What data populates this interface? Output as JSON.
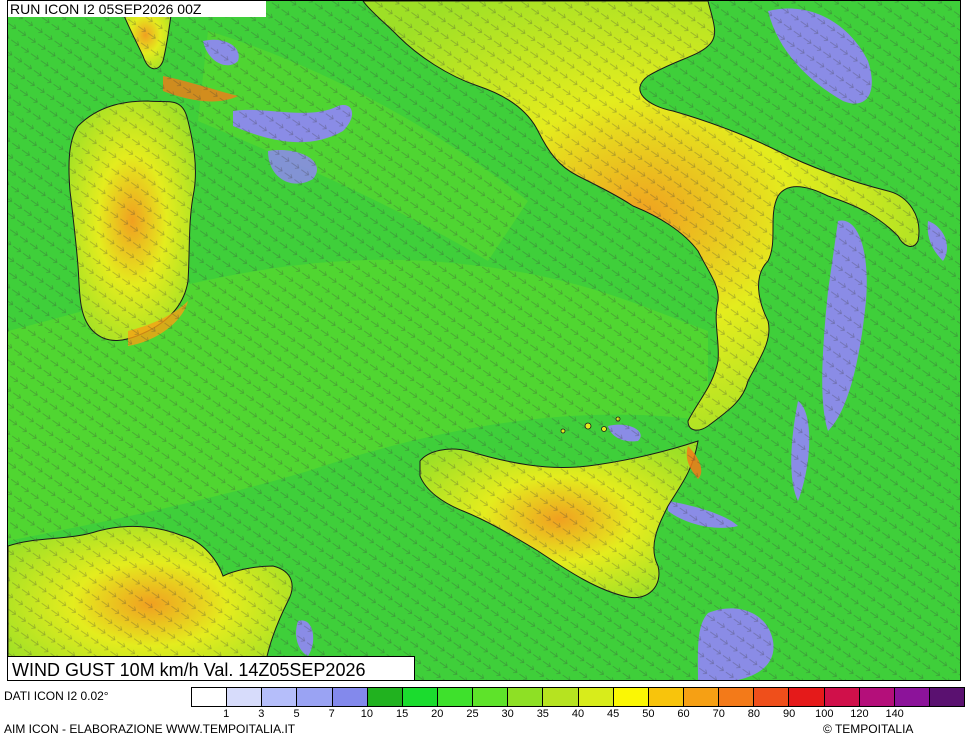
{
  "header": {
    "run_label": "RUN ICON I2 05SEP2026 00Z"
  },
  "map": {
    "field": "wind gust 10m",
    "colors": {
      "sea_base": "#3fcf3a",
      "sea_strong": "#5fdc2a",
      "calm_zone": "#8a8ce6",
      "land_low": "#9ee026",
      "land_mid": "#e4ec1e",
      "land_high": "#f0a020",
      "coastline": "#1a1a1a",
      "arrows": "#555555"
    }
  },
  "title": {
    "text": "WIND GUST 10M km/h Val. 14Z05SEP2026"
  },
  "footer": {
    "data_source": "DATI ICON I2 0.02°",
    "elaboration": "AIM ICON - ELABORAZIONE WWW.TEMPOITALIA.IT",
    "copyright": "© TEMPOITALIA"
  },
  "legend": {
    "colors": [
      "#ffffff",
      "#d7dcfb",
      "#b5befa",
      "#9aa3f3",
      "#8389ec",
      "#21b21f",
      "#1bdc2e",
      "#3ee12c",
      "#5ee32a",
      "#8ee025",
      "#b6e320",
      "#d8ec1b",
      "#fbf704",
      "#f8c40c",
      "#f6a014",
      "#f37a19",
      "#ef4f1b",
      "#e51a1a",
      "#d0104a",
      "#b40f7a",
      "#8c139a",
      "#5a1170"
    ],
    "ticks": [
      "1",
      "3",
      "5",
      "7",
      "10",
      "15",
      "20",
      "25",
      "30",
      "35",
      "40",
      "45",
      "50",
      "60",
      "70",
      "80",
      "90",
      "100",
      "120",
      "140"
    ]
  }
}
